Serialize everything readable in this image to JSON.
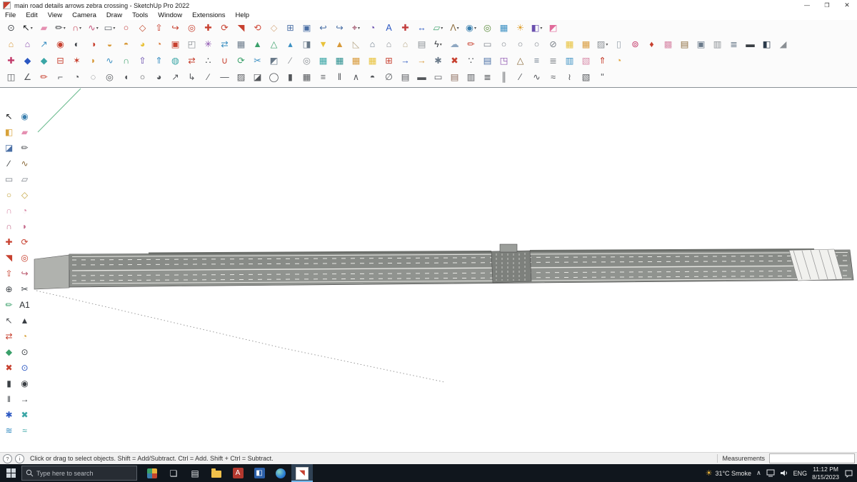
{
  "window": {
    "title": "main road details arrows zebra crossing - SketchUp Pro 2022",
    "controls": {
      "minimize": "—",
      "maximize": "❐",
      "close": "✕"
    }
  },
  "menu": {
    "items": [
      "File",
      "Edit",
      "View",
      "Camera",
      "Draw",
      "Tools",
      "Window",
      "Extensions",
      "Help"
    ]
  },
  "toolbars": {
    "row1": [
      [
        "zoom-icon",
        "⊙",
        "#45494e",
        0
      ],
      [
        "select-tool",
        "↖",
        "#16181a",
        1
      ],
      [
        "eraser-tool",
        "▰",
        "#e58fb1",
        0
      ],
      [
        "line-tool",
        "✏",
        "#3a3d40",
        1
      ],
      [
        "arc-tool",
        "∩",
        "#c23b4f",
        1
      ],
      [
        "freehand-tool",
        "∿",
        "#c2527a",
        1
      ],
      [
        "rectangle-tool",
        "▭",
        "#5a6067",
        1
      ],
      [
        "circle-tool",
        "○",
        "#c23b3b",
        0
      ],
      [
        "polygon-tool",
        "◇",
        "#c24b2f",
        0
      ],
      [
        "push-pull-tool",
        "⇧",
        "#c7402f",
        0
      ],
      [
        "follow-me-tool",
        "↪",
        "#c7402f",
        0
      ],
      [
        "offset-tool",
        "◎",
        "#c7402f",
        0
      ],
      [
        "move-tool",
        "✚",
        "#c7402f",
        0
      ],
      [
        "rotate-tool",
        "⟳",
        "#c7402f",
        0
      ],
      [
        "scale-tool",
        "◥",
        "#c7402f",
        0
      ],
      [
        "orbit-tool",
        "⟲",
        "#d04a3a",
        0
      ],
      [
        "pan-tool",
        "◇",
        "#d6ac83",
        0
      ],
      [
        "zoom-window-tool",
        "⊞",
        "#4a6fa5",
        0
      ],
      [
        "zoom-extents-tool",
        "▣",
        "#4a6fa5",
        0
      ],
      [
        "previous-view-tool",
        "↩",
        "#4a6fa5",
        0
      ],
      [
        "next-view-tool",
        "↪",
        "#4a6fa5",
        0
      ],
      [
        "tape-measure-tool",
        "⌖",
        "#8a2b4a",
        1
      ],
      [
        "protractor-tool",
        "◔",
        "#6a4fae",
        0
      ],
      [
        "text-tool",
        "A",
        "#2b57c2",
        0
      ],
      [
        "axes-tool",
        "✚",
        "#c23b3b",
        0
      ],
      [
        "dimension-tool",
        "↔",
        "#2b57c2",
        0
      ],
      [
        "section-plane-tool",
        "▱",
        "#3aa06a",
        1
      ],
      [
        "walk-tool",
        "Λ",
        "#8a6a3a",
        1
      ],
      [
        "look-around-tool",
        "◉",
        "#3a7fae",
        1
      ],
      [
        "position-camera-tool",
        "◎",
        "#5a8a3a",
        0
      ],
      [
        "match-photo-icon",
        "▦",
        "#3a8fc2",
        0
      ],
      [
        "shadows-icon",
        "☀",
        "#e0a53a",
        0
      ],
      [
        "styles-icon",
        "◧",
        "#6a4fae",
        1
      ],
      [
        "materials-icon",
        "◩",
        "#e06a9a",
        0
      ]
    ],
    "row2": [
      [
        "3d-warehouse-icon",
        "⌂",
        "#d89a3a",
        0
      ],
      [
        "extension-warehouse-icon",
        "⌂",
        "#8a4fae",
        0
      ],
      [
        "share-model-icon",
        "↗",
        "#3a8fc2",
        0
      ],
      [
        "solid-outer-shell-icon",
        "◉",
        "#c7402f",
        0
      ],
      [
        "solid-intersect-icon",
        "◐",
        "#3a3f44",
        0
      ],
      [
        "solid-union-icon",
        "◑",
        "#c7402f",
        0
      ],
      [
        "solid-subtract-icon",
        "◒",
        "#d89a3a",
        0
      ],
      [
        "solid-trim-icon",
        "◓",
        "#d89a3a",
        0
      ],
      [
        "solid-split-icon",
        "◕",
        "#e8c23a",
        0
      ],
      [
        "soften-edges-icon",
        "◔",
        "#d87a3a",
        0
      ],
      [
        "make-component-icon",
        "▣",
        "#c7402f",
        0
      ],
      [
        "make-group-icon",
        "◰",
        "#8a8f94",
        0
      ],
      [
        "explode-icon",
        "✳",
        "#8a4fae",
        0
      ],
      [
        "flip-along-icon",
        "⇄",
        "#3a8fc2",
        0
      ],
      [
        "array-copy-icon",
        "▦",
        "#6a7a8a",
        0
      ],
      [
        "sandbox-contours-icon",
        "▲",
        "#3aa06a",
        0
      ],
      [
        "sandbox-scratch-icon",
        "△",
        "#3aa06a",
        0
      ],
      [
        "smoove-icon",
        "▴",
        "#3a8fc2",
        0
      ],
      [
        "stamp-icon",
        "◨",
        "#6a7a8a",
        0
      ],
      [
        "drape-icon",
        "▼",
        "#e8c23a",
        0
      ],
      [
        "add-detail-icon",
        "▲",
        "#d89a3a",
        0
      ],
      [
        "flip-edge-icon",
        "◺",
        "#b8a88a",
        0
      ],
      [
        "house-icon",
        "⌂",
        "#6a7a8a",
        0
      ],
      [
        "floorplan-icon",
        "⌂",
        "#8a8f94",
        0
      ],
      [
        "roof-icon",
        "⌂",
        "#b8a88a",
        0
      ],
      [
        "instant-wall-icon",
        "▤",
        "#8a8f94",
        0
      ],
      [
        "jhs-powerbar-icon",
        "ϟ",
        "#3a3f44",
        1
      ],
      [
        "cloud-icon",
        "☁",
        "#8fa8c2",
        0
      ],
      [
        "sketch-marker-icon",
        "✏",
        "#c7402f",
        0
      ],
      [
        "shape-rect-icon",
        "▭",
        "#7a8088",
        0
      ],
      [
        "shape-oval-icon",
        "○",
        "#7a8088",
        0
      ],
      [
        "shape-oval2-icon",
        "○",
        "#7a8088",
        0
      ],
      [
        "shape-oval3-icon",
        "○",
        "#7a8088",
        0
      ],
      [
        "shape-oval-slash-icon",
        "⊘",
        "#7a8088",
        0
      ],
      [
        "grid-tool-icon",
        "▦",
        "#e8c23a",
        0
      ],
      [
        "grid-tool2-icon",
        "▦",
        "#d89a3a",
        0
      ],
      [
        "hatch-tool-icon",
        "▨",
        "#8a8f94",
        1
      ],
      [
        "page-icon",
        "▯",
        "#9aa4ae",
        0
      ],
      [
        "laser-icon",
        "⊚",
        "#c43b6a",
        0
      ],
      [
        "red-pin-icon",
        "♦",
        "#c7402f",
        0
      ],
      [
        "material-swatch-icon",
        "▩",
        "#d88aa8",
        0
      ],
      [
        "library-icon",
        "▤",
        "#8a6a3a",
        0
      ],
      [
        "frame-icon",
        "▣",
        "#6a7a8a",
        0
      ],
      [
        "pages-icon",
        "▥",
        "#8a8f94",
        0
      ],
      [
        "cube-stack-icon",
        "≣",
        "#6a7a8a",
        0
      ],
      [
        "monitor-icon",
        "▬",
        "#3a3f44",
        0
      ],
      [
        "render-icon",
        "◧",
        "#2b3a4a",
        0
      ],
      [
        "slope-page-icon",
        "◢",
        "#8a8f94",
        0
      ]
    ],
    "row3": [
      [
        "fredo-menu-icon",
        "✚",
        "#c23b6a",
        0
      ],
      [
        "blue-diamond-icon",
        "◆",
        "#2b57c2",
        0
      ],
      [
        "teal-diamond-icon",
        "◆",
        "#3aa6a6",
        0
      ],
      [
        "ab-label-icon",
        "⊟",
        "#c7402f",
        0
      ],
      [
        "red-star-icon",
        "✶",
        "#c7402f",
        0
      ],
      [
        "round-corner-icon",
        "◗",
        "#d89a3a",
        0
      ],
      [
        "bezier-curve-icon",
        "∿",
        "#3a8fc2",
        0
      ],
      [
        "curviloft-icon",
        "∩",
        "#3aa06a",
        0
      ],
      [
        "joint-push-pull-icon",
        "⇧",
        "#6a4fae",
        0
      ],
      [
        "vector-push-icon",
        "⇑",
        "#3a8fc2",
        0
      ],
      [
        "surface-tools-icon",
        "◍",
        "#3aa6a6",
        0
      ],
      [
        "mirror-icon",
        "⇄",
        "#c7402f",
        0
      ],
      [
        "copy-along-icon",
        "∴",
        "#3a3f44",
        0
      ],
      [
        "weld-edges-icon",
        "∪",
        "#c7402f",
        0
      ],
      [
        "purge-icon",
        "⟳",
        "#3aa06a",
        0
      ],
      [
        "cleanup-icon",
        "✂",
        "#3a8fc2",
        0
      ],
      [
        "selection-toys-icon",
        "◩",
        "#6a7a8a",
        0
      ],
      [
        "edge-tools-icon",
        "∕",
        "#8a8f94",
        0
      ],
      [
        "pipe-along-icon",
        "◎",
        "#8a8f94",
        0
      ],
      [
        "teal-grid-icon",
        "▦",
        "#3aa6a6",
        0
      ],
      [
        "teal-grid2-icon",
        "▦",
        "#2b8f8f",
        0
      ],
      [
        "orange-grid-icon",
        "▦",
        "#d89a3a",
        0
      ],
      [
        "yellow-grid-icon",
        "▦",
        "#e8c23a",
        0
      ],
      [
        "red-grid-icon",
        "⊞",
        "#c7402f",
        0
      ],
      [
        "blue-arrow-icon",
        "→",
        "#2b57c2",
        0
      ],
      [
        "orange-arrow-icon",
        "→",
        "#d89a3a",
        0
      ],
      [
        "gear-icon",
        "✱",
        "#6a7a8a",
        0
      ],
      [
        "red-cross-icon",
        "✖",
        "#c7402f",
        0
      ],
      [
        "dots-tool-icon",
        "∵",
        "#3a3f44",
        0
      ],
      [
        "component-list-icon",
        "▤",
        "#4a6fa5",
        0
      ],
      [
        "scale-box-icon",
        "◳",
        "#8a4fae",
        0
      ],
      [
        "truss-icon",
        "△",
        "#8a6a3a",
        0
      ],
      [
        "stairs-icon",
        "≡",
        "#6a7a8a",
        0
      ],
      [
        "fence-icon",
        "≣",
        "#8a8f94",
        0
      ],
      [
        "panel-icon",
        "▥",
        "#3a8fc2",
        0
      ],
      [
        "pattern-icon",
        "▧",
        "#d88aa8",
        0
      ],
      [
        "north-arrow-icon",
        "⇑",
        "#c7402f",
        0
      ],
      [
        "sun-angle-icon",
        "◔",
        "#e0a53a",
        0
      ]
    ],
    "row4": [
      [
        "mirror-plane-icon",
        "◫",
        "#53565a",
        0
      ],
      [
        "angle-guide-icon",
        "∠",
        "#53565a",
        0
      ],
      [
        "red-pencil-icon",
        "✏",
        "#c7402f",
        0
      ],
      [
        "corner-icon",
        "⌐",
        "#53565a",
        0
      ],
      [
        "quarter-circle-icon",
        "◔",
        "#53565a",
        0
      ],
      [
        "dashed-circle-icon",
        "◌",
        "#53565a",
        0
      ],
      [
        "donut-icon",
        "◎",
        "#53565a",
        0
      ],
      [
        "half-shell-icon",
        "◖",
        "#53565a",
        0
      ],
      [
        "ring-icon",
        "○",
        "#53565a",
        0
      ],
      [
        "pie-icon",
        "◕",
        "#53565a",
        0
      ],
      [
        "arrow-ne-icon",
        "↗",
        "#53565a",
        0
      ],
      [
        "arrow-bend-icon",
        "↳",
        "#53565a",
        0
      ],
      [
        "diag-line-icon",
        "∕",
        "#53565a",
        0
      ],
      [
        "h-line-icon",
        "—",
        "#53565a",
        0
      ],
      [
        "hatch-icon-2",
        "▨",
        "#53565a",
        0
      ],
      [
        "wedge-icon",
        "◪",
        "#53565a",
        0
      ],
      [
        "cylinder-icon",
        "◯",
        "#53565a",
        0
      ],
      [
        "bar-icon",
        "▮",
        "#53565a",
        0
      ],
      [
        "mesh-icon",
        "▦",
        "#53565a",
        0
      ],
      [
        "rows-icon",
        "≡",
        "#53565a",
        0
      ],
      [
        "cols-icon",
        "‖",
        "#53565a",
        0
      ],
      [
        "peak-icon",
        "∧",
        "#53565a",
        0
      ],
      [
        "dome-icon",
        "◓",
        "#53565a",
        0
      ],
      [
        "null-icon",
        "∅",
        "#53565a",
        0
      ],
      [
        "planks-icon",
        "▤",
        "#53565a",
        0
      ],
      [
        "beam-icon",
        "▬",
        "#53565a",
        0
      ],
      [
        "frame-outline-icon",
        "▭",
        "#53565a",
        0
      ],
      [
        "brick-icon",
        "▤",
        "#8a6a5a",
        0
      ],
      [
        "panel-lines-icon",
        "▥",
        "#53565a",
        0
      ],
      [
        "louver-icon",
        "≣",
        "#53565a",
        0
      ],
      [
        "pipes-icon",
        "║",
        "#53565a",
        0
      ],
      [
        "slash-icon",
        "⁄",
        "#53565a",
        0
      ],
      [
        "s-curve-icon",
        "∿",
        "#53565a",
        0
      ],
      [
        "wave-icon",
        "≈",
        "#53565a",
        0
      ],
      [
        "zigzag-icon",
        "≀",
        "#53565a",
        0
      ],
      [
        "hatch-dense-icon",
        "▧",
        "#53565a",
        0
      ],
      [
        "double-prime-icon",
        "ʺ",
        "#53565a",
        0
      ]
    ]
  },
  "left_toolbar": [
    [
      "select-arrow-tool",
      "↖",
      "#16181a",
      0
    ],
    [
      "look-around-tool-left",
      "◉",
      "#3a7fae",
      0
    ],
    [
      "paint-bucket-tool",
      "◧",
      "#d8a23a",
      0
    ],
    [
      "eraser-tool-left",
      "▰",
      "#e58fb1",
      0
    ],
    [
      "component-browser-tool",
      "◪",
      "#4a6fa5",
      0
    ],
    [
      "pencil-tool",
      "✏",
      "#53565a",
      0
    ],
    [
      "line-tool-left",
      "∕",
      "#2a2d30",
      0
    ],
    [
      "freehand-tool-left",
      "∿",
      "#8a6a3a",
      0
    ],
    [
      "rectangle-tool-left",
      "▭",
      "#7a8088",
      0
    ],
    [
      "rotated-rectangle-tool",
      "▱",
      "#7a8088",
      0
    ],
    [
      "circle-tool-left",
      "○",
      "#c2a23a",
      0
    ],
    [
      "polygon-tool-left",
      "◇",
      "#c2a23a",
      0
    ],
    [
      "arc-tool-left",
      "∩",
      "#d88aa8",
      0
    ],
    [
      "pie-tool-left",
      "◔",
      "#d88aa8",
      0
    ],
    [
      "two-point-arc-tool",
      "∩",
      "#c46a8a",
      0
    ],
    [
      "three-point-arc-tool",
      "◗",
      "#c46a8a",
      0
    ],
    [
      "move-tool-left",
      "✚",
      "#c7402f",
      0
    ],
    [
      "rotate-tool-left",
      "⟳",
      "#c7402f",
      0
    ],
    [
      "scale-tool-left",
      "◥",
      "#c7402f",
      0
    ],
    [
      "offset-tool-left",
      "◎",
      "#c7402f",
      0
    ],
    [
      "push-pull-tool-left",
      "⇧",
      "#c7402f",
      0
    ],
    [
      "follow-me-tool-left",
      "↪",
      "#b8556a",
      0
    ],
    [
      "zoom-tool-left",
      "⊕",
      "#3a3f44",
      0
    ],
    [
      "scissors-tool",
      "✂",
      "#3a3f44",
      0
    ],
    [
      "dimension-pencil-tool",
      "✏",
      "#3aa06a",
      0
    ],
    [
      "text-a1-tool",
      "A1",
      "#2a2d30",
      0
    ],
    [
      "select-alt-tool",
      "↖",
      "#53565a",
      0
    ],
    [
      "cone-3d-tool",
      "▲",
      "#3a3f44",
      0
    ],
    [
      "swap-red-tool",
      "⇄",
      "#c7402f",
      0
    ],
    [
      "bucket-alt-tool",
      "◔",
      "#d8a23a",
      0
    ],
    [
      "green-diamond-tool",
      "◆",
      "#3aa06a",
      0
    ],
    [
      "magnifier-dark-tool",
      "⊙",
      "#3a3f44",
      0
    ],
    [
      "delete-red-tool",
      "✖",
      "#c7402f",
      0
    ],
    [
      "zoom-blue-tool",
      "⊙",
      "#2b57c2",
      0
    ],
    [
      "bar-dark-tool",
      "▮",
      "#3a3f44",
      0
    ],
    [
      "eye-dark-tool",
      "◉",
      "#3a3f44",
      0
    ],
    [
      "columns-dark-tool",
      "‖",
      "#3a3f44",
      0
    ],
    [
      "arrow-right-tool",
      "→",
      "#3a3f44",
      0
    ],
    [
      "blue-burst-tool",
      "✱",
      "#2b57c2",
      0
    ],
    [
      "teal-x-tool",
      "✖",
      "#3aa6a6",
      0
    ],
    [
      "layer-stack-tool",
      "≋",
      "#3a8fc2",
      0
    ],
    [
      "waves-tool",
      "≈",
      "#3aa6a6",
      0
    ]
  ],
  "canvas": {
    "colors": {
      "background": "#ffffff",
      "road": "#90938f",
      "road_dark": "#7d807c",
      "end_cap": "#b0b2ae",
      "marking": "#e9e9e5",
      "axis_green": "#6fbd92",
      "guide": "#8f8f8f",
      "crosswalk": "#f1f1ee"
    }
  },
  "statusbar": {
    "help_glyph": "?",
    "geo_glyph": "i",
    "hint": "Click or drag to select objects. Shift = Add/Subtract. Ctrl = Add. Shift + Ctrl = Subtract.",
    "measurements_label": "Measurements"
  },
  "taskbar": {
    "search_placeholder": "Type here to search",
    "apps": [
      {
        "n": "photos-app",
        "t": "multi"
      },
      {
        "n": "task-view-button",
        "g": "❏",
        "c": "#dfe3e6"
      },
      {
        "n": "store-app",
        "g": "▤",
        "c": "#dfe3e6"
      },
      {
        "n": "file-explorer-app",
        "t": "folder"
      },
      {
        "n": "autocad-app",
        "g": "A",
        "c": "#ffffff",
        "bg": "#b3382e"
      },
      {
        "n": "pinned-blue-app",
        "g": "◧",
        "c": "#ffffff",
        "bg": "#2b5fa8"
      },
      {
        "n": "edge-browser-app",
        "t": "edge"
      },
      {
        "n": "sketchup-app",
        "t": "sketchup",
        "active": true
      }
    ],
    "tray": {
      "temp": "31°C Smoke",
      "lang": "ENG",
      "time": "11:12 PM",
      "date": "8/15/2023"
    }
  }
}
